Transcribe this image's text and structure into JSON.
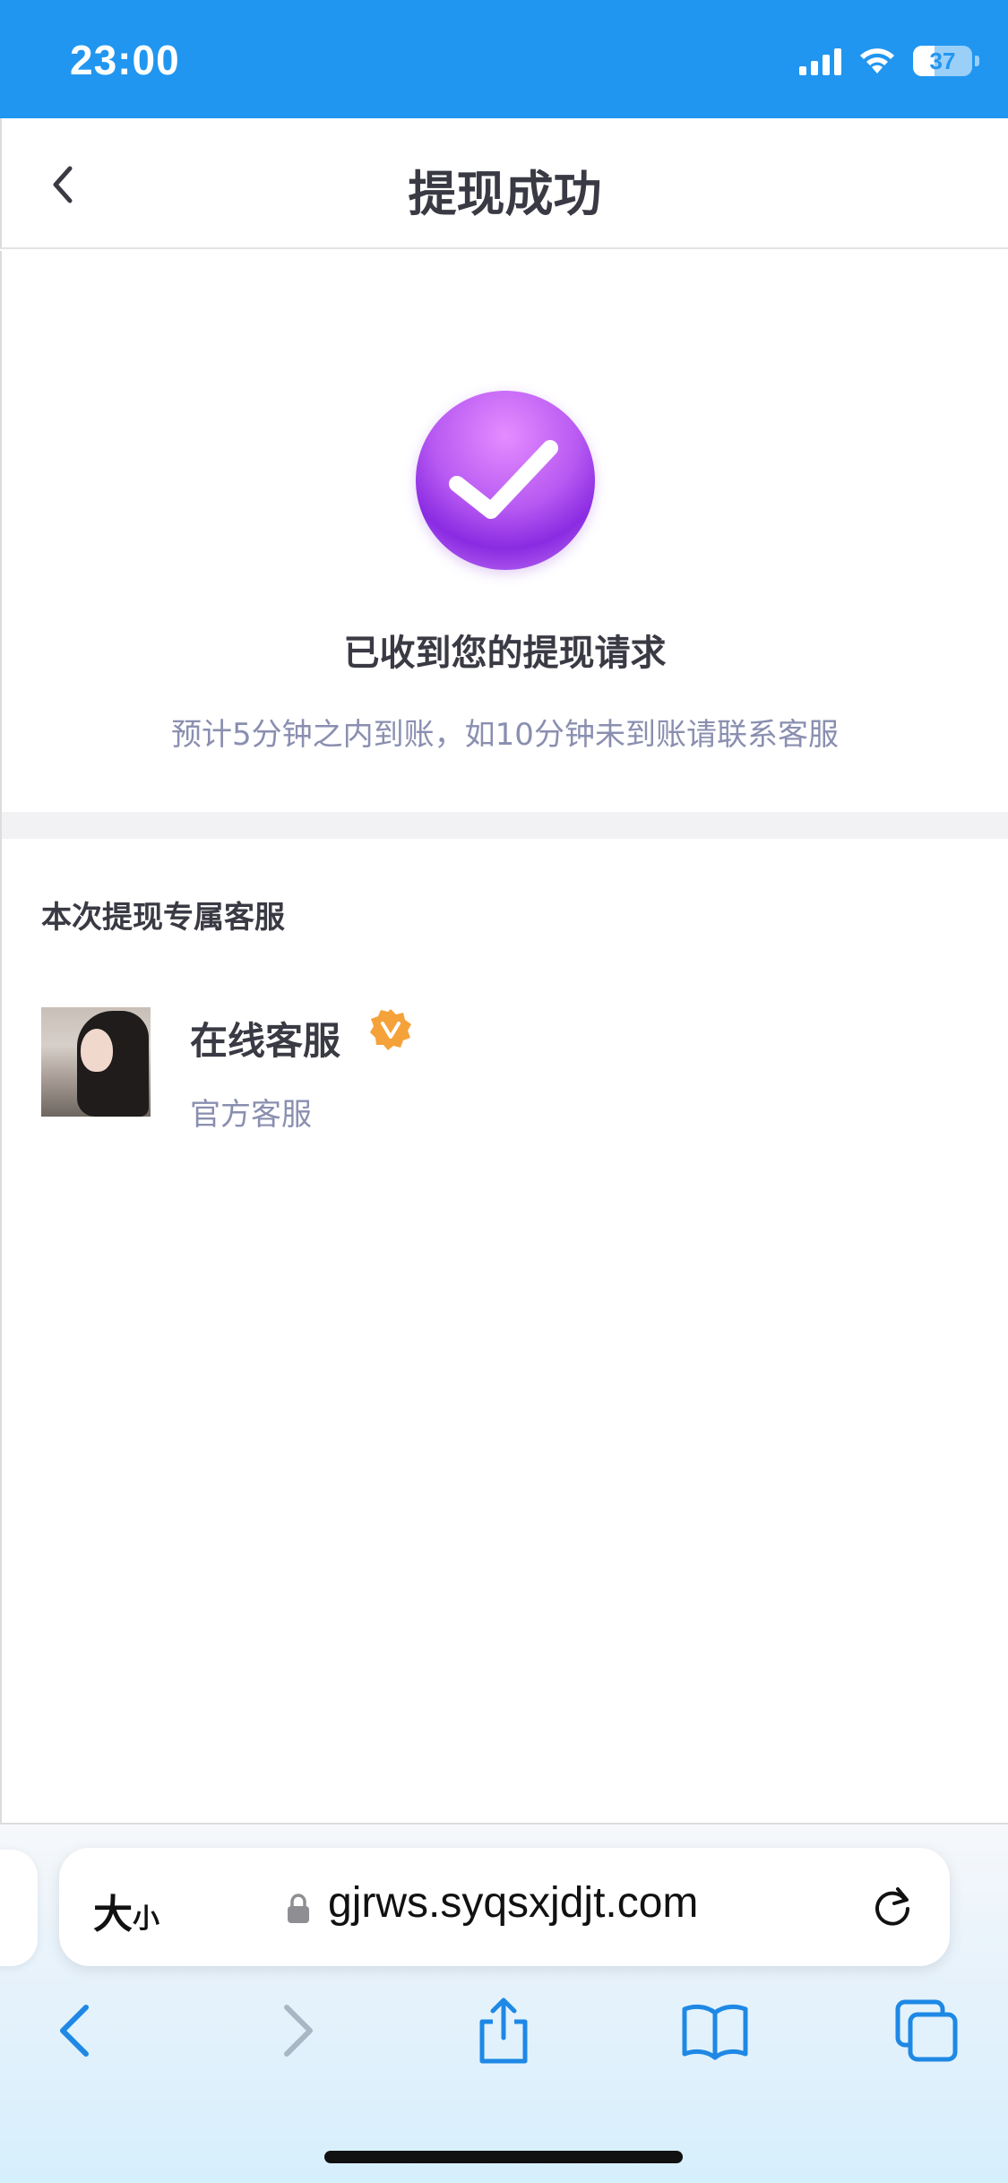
{
  "status_bar": {
    "time": "23:00",
    "battery": "37",
    "battery_level": 0.37,
    "icons": [
      "signal-icon",
      "wifi-icon",
      "battery-icon"
    ]
  },
  "nav": {
    "title": "提现成功",
    "back_icon": "chevron-left-icon"
  },
  "success": {
    "icon": "check-circle-icon",
    "title": "已收到您的提现请求",
    "subtitle": "预计5分钟之内到账，如10分钟未到账请联系客服"
  },
  "service": {
    "section_title": "本次提现专属客服",
    "name": "在线客服",
    "subtitle": "官方客服",
    "verified_icon": "verified-badge-icon"
  },
  "browser": {
    "text_size_big": "大",
    "text_size_small": "小",
    "url": "gjrws.syqsxjdjt.com",
    "toolbar": [
      "back-icon",
      "forward-icon",
      "share-icon",
      "bookmarks-icon",
      "tabs-icon"
    ]
  },
  "colors": {
    "status_bar": "#2196f0",
    "accent_purple": "#9b3ef0",
    "verified": "#f5a23a",
    "ios_blue": "#1e88e5"
  }
}
